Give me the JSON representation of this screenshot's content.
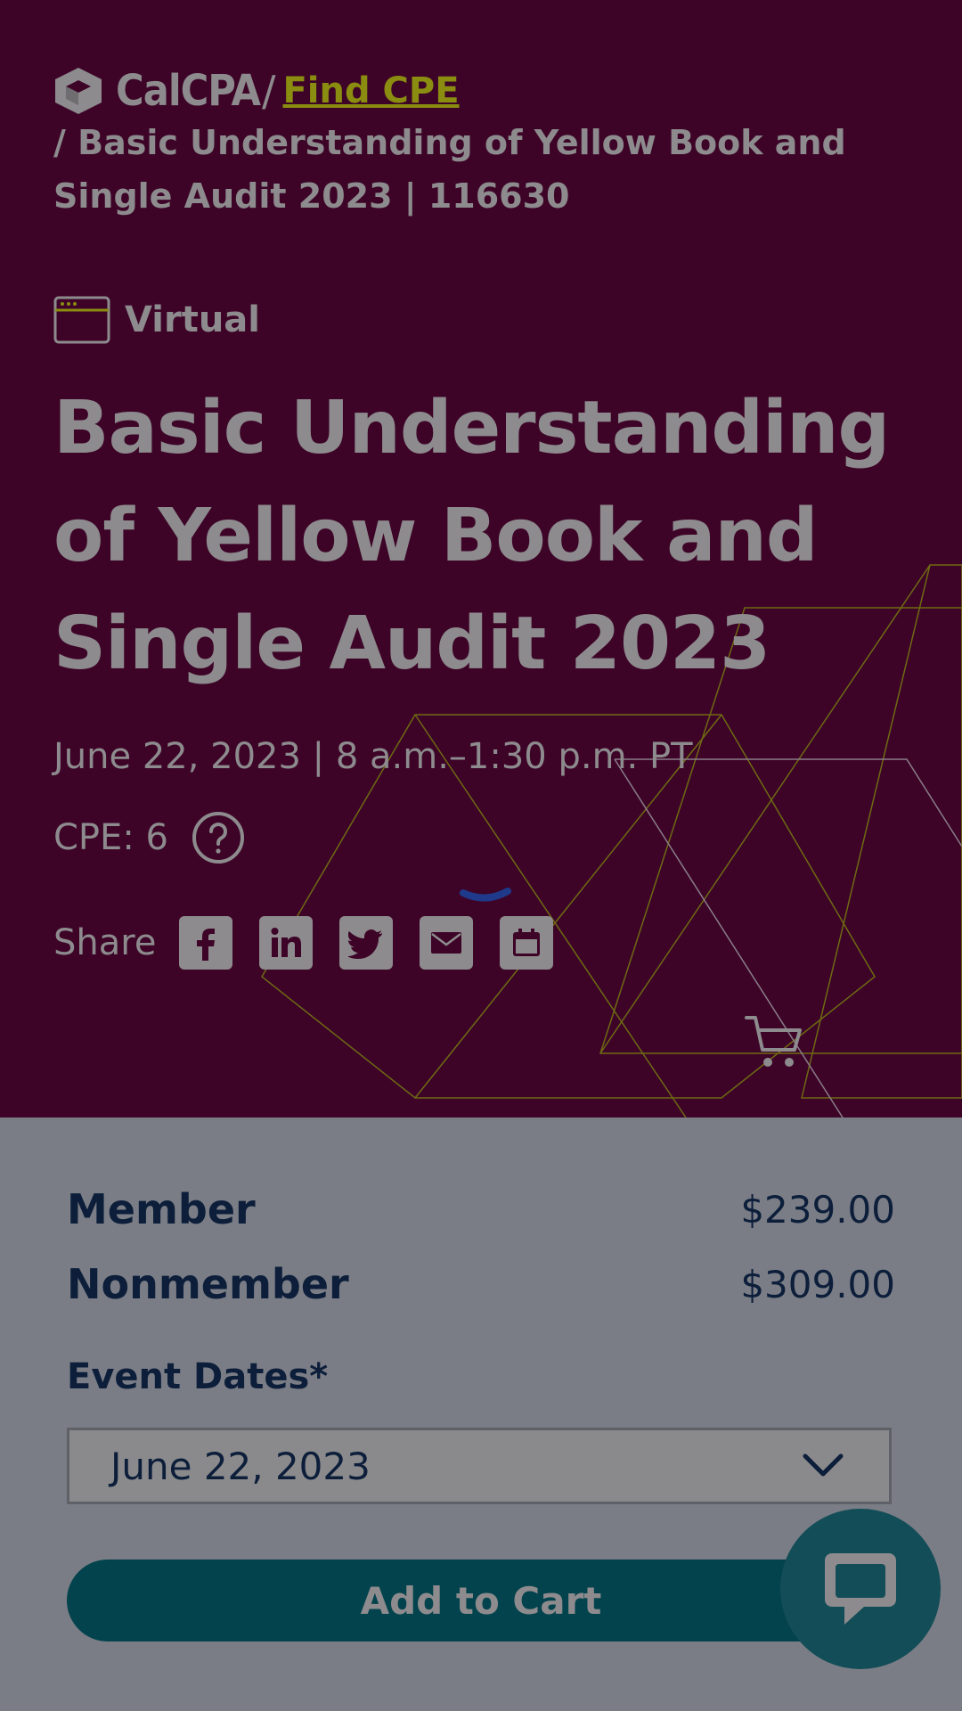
{
  "breadcrumb": {
    "logo_text": "CalCPA",
    "separator": "/",
    "link_label": "Find CPE",
    "current": "/ Basic Understanding of Yellow Book and Single Audit 2023 | 116630"
  },
  "event": {
    "format_icon": "browser-window-icon",
    "format_label": "Virtual",
    "title": "Basic Understanding of Yellow Book and Single Audit 2023",
    "date_time": "June 22, 2023 | 8 a.m.–1:30 p.m. PT",
    "cpe_label": "CPE: 6"
  },
  "share": {
    "label": "Share",
    "buttons": [
      "facebook-icon",
      "linkedin-icon",
      "twitter-icon",
      "email-icon",
      "calendar-icon"
    ]
  },
  "pricing": {
    "member_label": "Member",
    "member_price": "$239.00",
    "nonmember_label": "Nonmember",
    "nonmember_price": "$309.00"
  },
  "event_dates": {
    "label": "Event Dates*",
    "selected": "June 22, 2023"
  },
  "cart": {
    "button_label": "Add to Cart"
  },
  "colors": {
    "hero_bg": "#3d0428",
    "accent_link": "#8a8d10",
    "panel_bg": "#7a7d85",
    "cta_bg": "#03434d",
    "text_dark": "#0c1e3a"
  }
}
